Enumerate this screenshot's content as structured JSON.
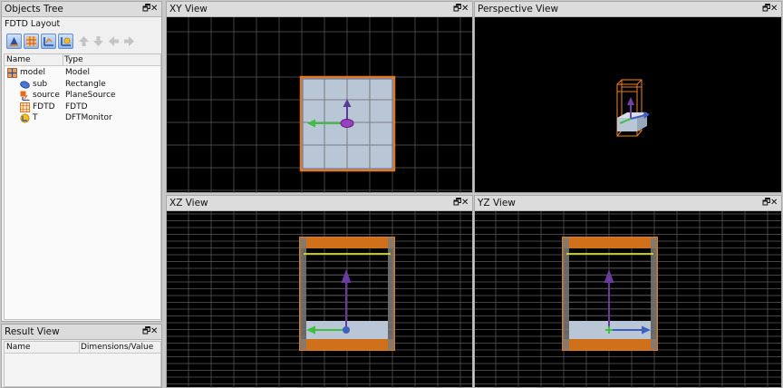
{
  "objects_tree": {
    "title": "Objects Tree",
    "layout_label": "FDTD Layout",
    "columns": {
      "name": "Name",
      "type": "Type"
    },
    "items": [
      {
        "name": "model",
        "type": "Model",
        "icon": "model-icon"
      },
      {
        "name": "sub",
        "type": "Rectangle",
        "icon": "rectangle-icon"
      },
      {
        "name": "source",
        "type": "PlaneSource",
        "icon": "plane-source-icon"
      },
      {
        "name": "FDTD",
        "type": "FDTD",
        "icon": "fdtd-icon"
      },
      {
        "name": "T",
        "type": "DFTMonitor",
        "icon": "dft-monitor-icon"
      }
    ],
    "toolbar_icons": [
      "add-structure-icon",
      "add-grid-icon",
      "add-source-icon",
      "add-monitor-icon",
      "arrow-up-icon",
      "arrow-down-icon",
      "arrow-left-icon",
      "arrow-right-icon"
    ]
  },
  "result_view": {
    "title": "Result View",
    "columns": {
      "name": "Name",
      "value": "Dimensions/Value"
    }
  },
  "views": {
    "xy": "XY View",
    "perspective": "Perspective View",
    "xz": "XZ View",
    "yz": "YZ View"
  },
  "window_buttons": {
    "restore": "🗗",
    "close": "✕"
  },
  "colors": {
    "viewport_bg": "#000000",
    "grid": "#5a5a5a",
    "fdtd_border": "#e07a1c",
    "substrate_fill": "#b8c6d6",
    "source_line": "#d8e000",
    "axis_x": "#3fbf3f",
    "axis_y": "#7a3fa6",
    "axis_z": "#4060c0"
  }
}
